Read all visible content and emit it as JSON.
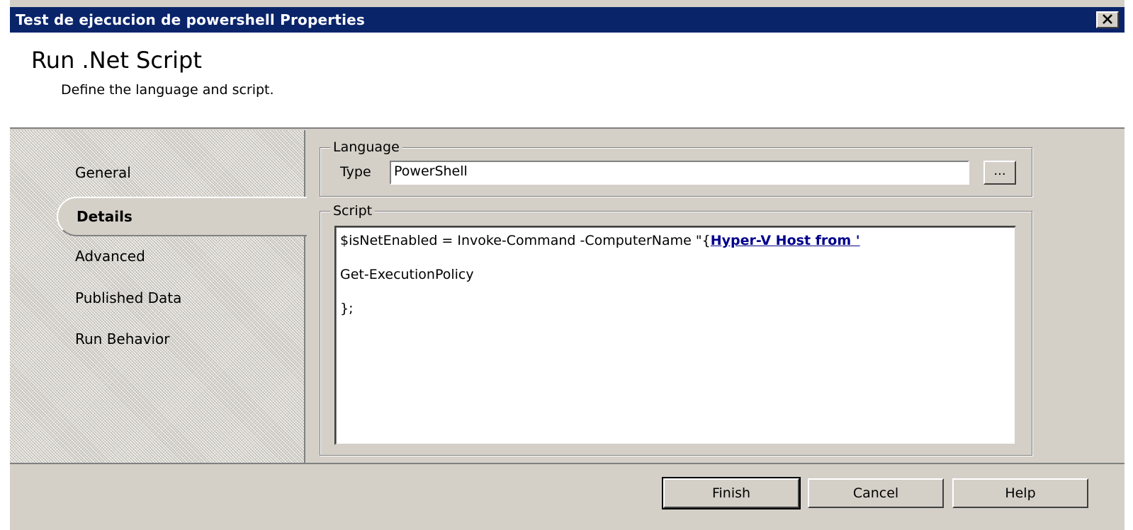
{
  "window": {
    "title": "Test de ejecucion de powershell Properties"
  },
  "header": {
    "title": "Run .Net Script",
    "subtitle": "Define the language and script."
  },
  "nav": {
    "items": [
      {
        "label": "General"
      },
      {
        "label": "Details",
        "selected": true
      },
      {
        "label": "Advanced"
      },
      {
        "label": "Published Data"
      },
      {
        "label": "Run Behavior"
      }
    ]
  },
  "language": {
    "legend": "Language",
    "type_label": "Type",
    "type_value": "PowerShell",
    "browse_label": "..."
  },
  "script": {
    "legend": "Script",
    "line1_text": "$isNetEnabled = Invoke-Command -ComputerName \"{",
    "line1_link": "Hyper-V Host from '",
    "line2": "Get-ExecutionPolicy",
    "line3": "};"
  },
  "footer": {
    "finish": "Finish",
    "cancel": "Cancel",
    "help": "Help"
  },
  "colors": {
    "titlebar": "#0a246a",
    "face": "#d4d0c8",
    "link": "#00008b"
  },
  "icons": {
    "close": "close-icon"
  }
}
